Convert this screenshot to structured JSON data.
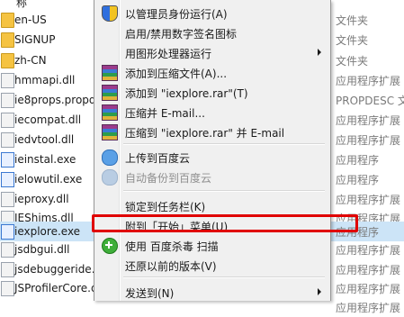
{
  "header_fragment": "称",
  "files": [
    {
      "name": "en-US",
      "type": "文件夹",
      "kind": "folder"
    },
    {
      "name": "SIGNUP",
      "type": "文件夹",
      "kind": "folder"
    },
    {
      "name": "zh-CN",
      "type": "文件夹",
      "kind": "folder"
    },
    {
      "name": "hmmapi.dll",
      "type": "应用程序扩展",
      "kind": "dll"
    },
    {
      "name": "ie8props.propdesc",
      "type": "PROPDESC 文件",
      "kind": "dll"
    },
    {
      "name": "iecompat.dll",
      "type": "应用程序扩展",
      "kind": "dll"
    },
    {
      "name": "iedvtool.dll",
      "type": "应用程序扩展",
      "kind": "dll"
    },
    {
      "name": "ieinstal.exe",
      "type": "应用程序",
      "kind": "exe"
    },
    {
      "name": "ielowutil.exe",
      "type": "应用程序",
      "kind": "exe"
    },
    {
      "name": "ieproxy.dll",
      "type": "应用程序扩展",
      "kind": "dll"
    },
    {
      "name": "IEShims.dll",
      "type": "应用程序扩展",
      "kind": "dll"
    },
    {
      "name": "iexplore.exe",
      "type": "应用程序",
      "kind": "exe",
      "selected": true
    },
    {
      "name": "jsdbgui.dll",
      "type": "应用程序扩展",
      "kind": "dll"
    },
    {
      "name": "jsdebuggeride.dll",
      "type": "应用程序扩展",
      "kind": "dll"
    },
    {
      "name": "JSProfilerCore.dll",
      "type": "应用程序扩展",
      "kind": "dll"
    },
    {
      "name": "",
      "type": "应用程序扩展",
      "kind": "dll"
    }
  ],
  "menu": {
    "run_as_admin": "以管理员身份运行(A)",
    "toggle_sign_icon": "启用/禁用数字签名图标",
    "run_with_gpu": "用图形处理器运行",
    "add_to_archive": "添加到压缩文件(A)...",
    "add_to_rar": "添加到 \"iexplore.rar\"(T)",
    "compress_email": "压缩并 E-mail...",
    "compress_rar_email": "压缩到 \"iexplore.rar\" 并 E-mail",
    "upload_baidu": "上传到百度云",
    "auto_backup_baidu": "自动备份到百度云",
    "pin_taskbar": "锁定到任务栏(K)",
    "pin_start": "附到「开始」菜单(U)",
    "baidu_scan": "使用 百度杀毒 扫描",
    "restore_previous": "还原以前的版本(V)",
    "send_to": "发送到(N)"
  },
  "colors": {
    "highlight_box": "#e00000",
    "selected_row": "#cce4f7"
  }
}
